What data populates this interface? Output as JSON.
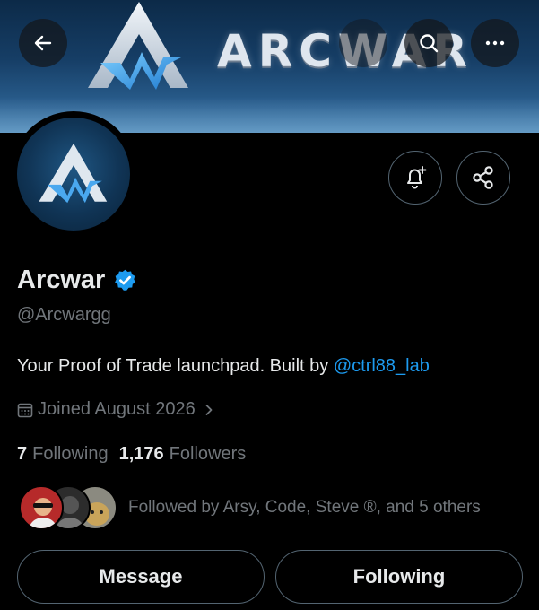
{
  "banner": {
    "wordmark": "ARCWAR"
  },
  "profile": {
    "name": "Arcwar",
    "handle": "@Arcwargg",
    "bio_text": "Your Proof of Trade launchpad. Built by ",
    "bio_mention": "@ctrl88_lab",
    "joined": "Joined August 2026"
  },
  "stats": {
    "following_count": "7",
    "following_label": "Following",
    "followers_count": "1,176",
    "followers_label": "Followers"
  },
  "followed_by": "Followed by Arsy, Code, Steve ®, and 5 others",
  "actions": {
    "message": "Message",
    "following": "Following"
  },
  "icons": {
    "back": "back-arrow-icon",
    "search": "search-icon",
    "more": "more-icon",
    "notify": "bell-plus-icon",
    "share": "share-icon",
    "verified": "verified-badge-icon",
    "calendar": "calendar-icon",
    "chevron": "chevron-right-icon"
  },
  "colors": {
    "accent": "#1d9bf0",
    "muted": "#71767b",
    "text": "#e7e9ea",
    "border": "#536471"
  }
}
